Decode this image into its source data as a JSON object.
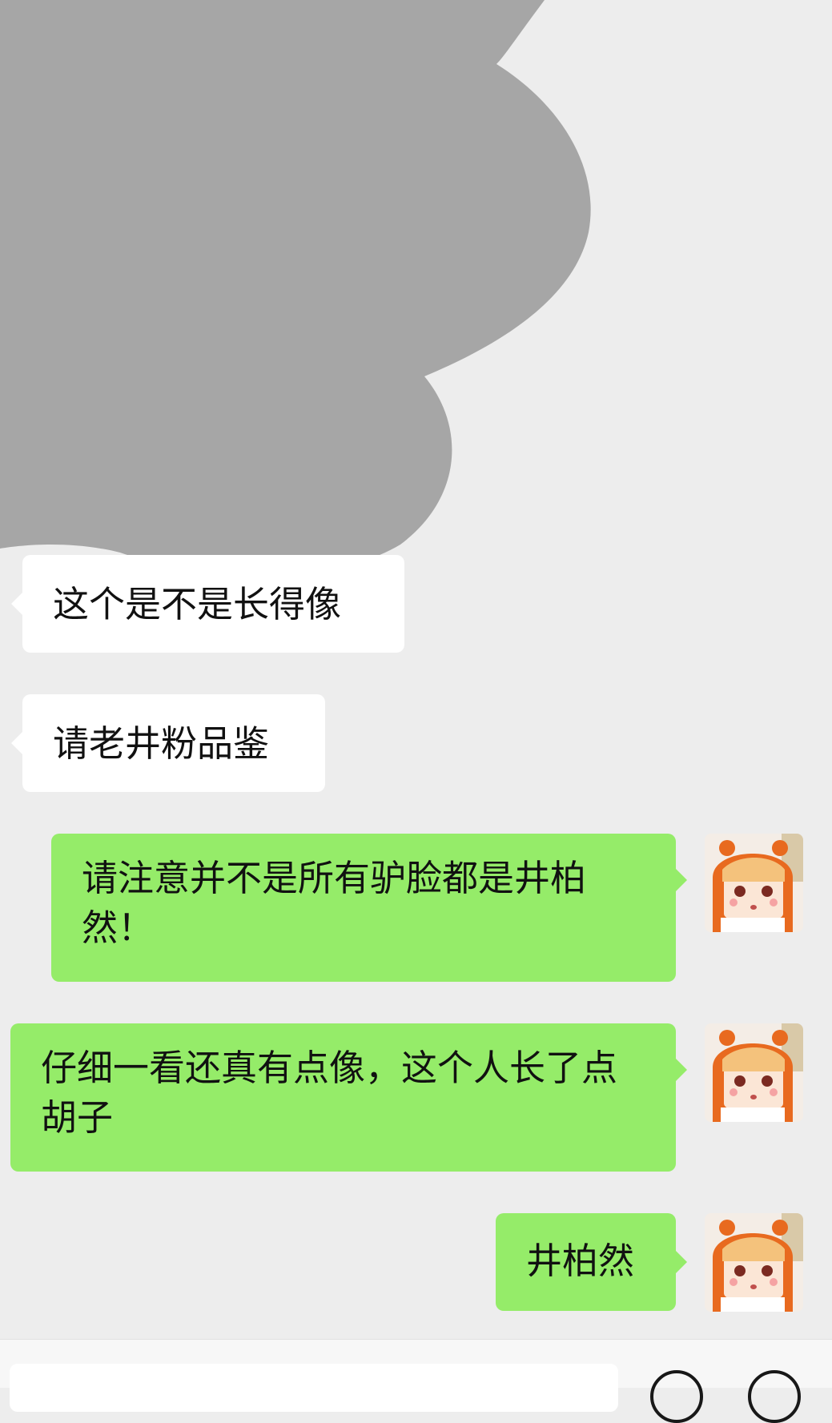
{
  "chat": {
    "messages": [
      {
        "side": "in",
        "text": "这个是不是长得像"
      },
      {
        "side": "in",
        "text": "请老井粉品鉴"
      },
      {
        "side": "out",
        "text": "请注意并不是所有驴脸都是井柏然！"
      },
      {
        "side": "out",
        "text": "仔细一看还真有点像，这个人长了点胡子"
      },
      {
        "side": "out",
        "text": "井柏然"
      }
    ]
  },
  "colors": {
    "background": "#ededed",
    "incoming_bubble": "#ffffff",
    "outgoing_bubble": "#95ec69",
    "redaction": "#a6a6a6"
  },
  "icons": {
    "input_bar": [
      "voice-icon",
      "emoji-icon"
    ]
  }
}
